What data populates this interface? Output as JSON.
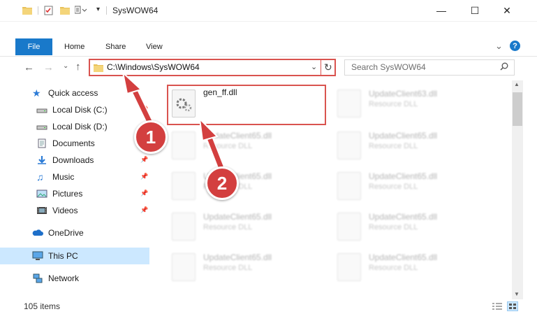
{
  "window": {
    "title": "SysWOW64",
    "minimize_glyph": "—",
    "maximize_glyph": "☐",
    "close_glyph": "✕"
  },
  "ribbon": {
    "tabs": [
      "File",
      "Home",
      "Share",
      "View"
    ],
    "collapse_glyph": "⌄",
    "help_glyph": "?"
  },
  "address": {
    "path": "C:\\Windows\\SysWOW64",
    "search_placeholder": "Search SysWOW64"
  },
  "nav": {
    "quick_access": "Quick access",
    "items": [
      {
        "label": "Local Disk (C:)",
        "icon": "drive-icon",
        "pinned": true
      },
      {
        "label": "Local Disk (D:)",
        "icon": "drive-icon",
        "pinned": false
      },
      {
        "label": "Documents",
        "icon": "documents-icon",
        "pinned": true
      },
      {
        "label": "Downloads",
        "icon": "downloads-icon",
        "pinned": true
      },
      {
        "label": "Music",
        "icon": "music-icon",
        "pinned": true
      },
      {
        "label": "Pictures",
        "icon": "pictures-icon",
        "pinned": true
      },
      {
        "label": "Videos",
        "icon": "videos-icon",
        "pinned": true
      }
    ],
    "onedrive": "OneDrive",
    "this_pc": "This PC",
    "network": "Network"
  },
  "files": {
    "selected": {
      "name": "gen_ff.dll"
    },
    "left_column": [
      {
        "name": "UpdateClient65.dll",
        "desc": "Resource DLL"
      },
      {
        "name": "UpdateClient65.dll",
        "desc": "Resource DLL"
      },
      {
        "name": "UpdateClient65.dll",
        "desc": "Resource DLL"
      },
      {
        "name": "UpdateClient65.dll",
        "desc": "Resource DLL"
      },
      {
        "name": "UpdateClient65.dll",
        "desc": "Resource DLL"
      }
    ],
    "right_column": [
      {
        "name": "UpdateClient63.dll",
        "desc": "Resource DLL"
      },
      {
        "name": "UpdateClient65.dll",
        "desc": "Resource DLL"
      },
      {
        "name": "UpdateClient65.dll",
        "desc": "Resource DLL"
      },
      {
        "name": "UpdateClient65.dll",
        "desc": "Resource DLL"
      },
      {
        "name": "UpdateClient65.dll",
        "desc": "Resource DLL"
      },
      {
        "name": "UpdateClient65.dll",
        "desc": "Resource DLL"
      }
    ]
  },
  "status": {
    "count": "105 items"
  },
  "callouts": [
    "1",
    "2"
  ],
  "colors": {
    "accent": "#1979ca",
    "highlight": "#d9534f",
    "callout": "#d33f3f",
    "selection": "#cce8ff"
  }
}
